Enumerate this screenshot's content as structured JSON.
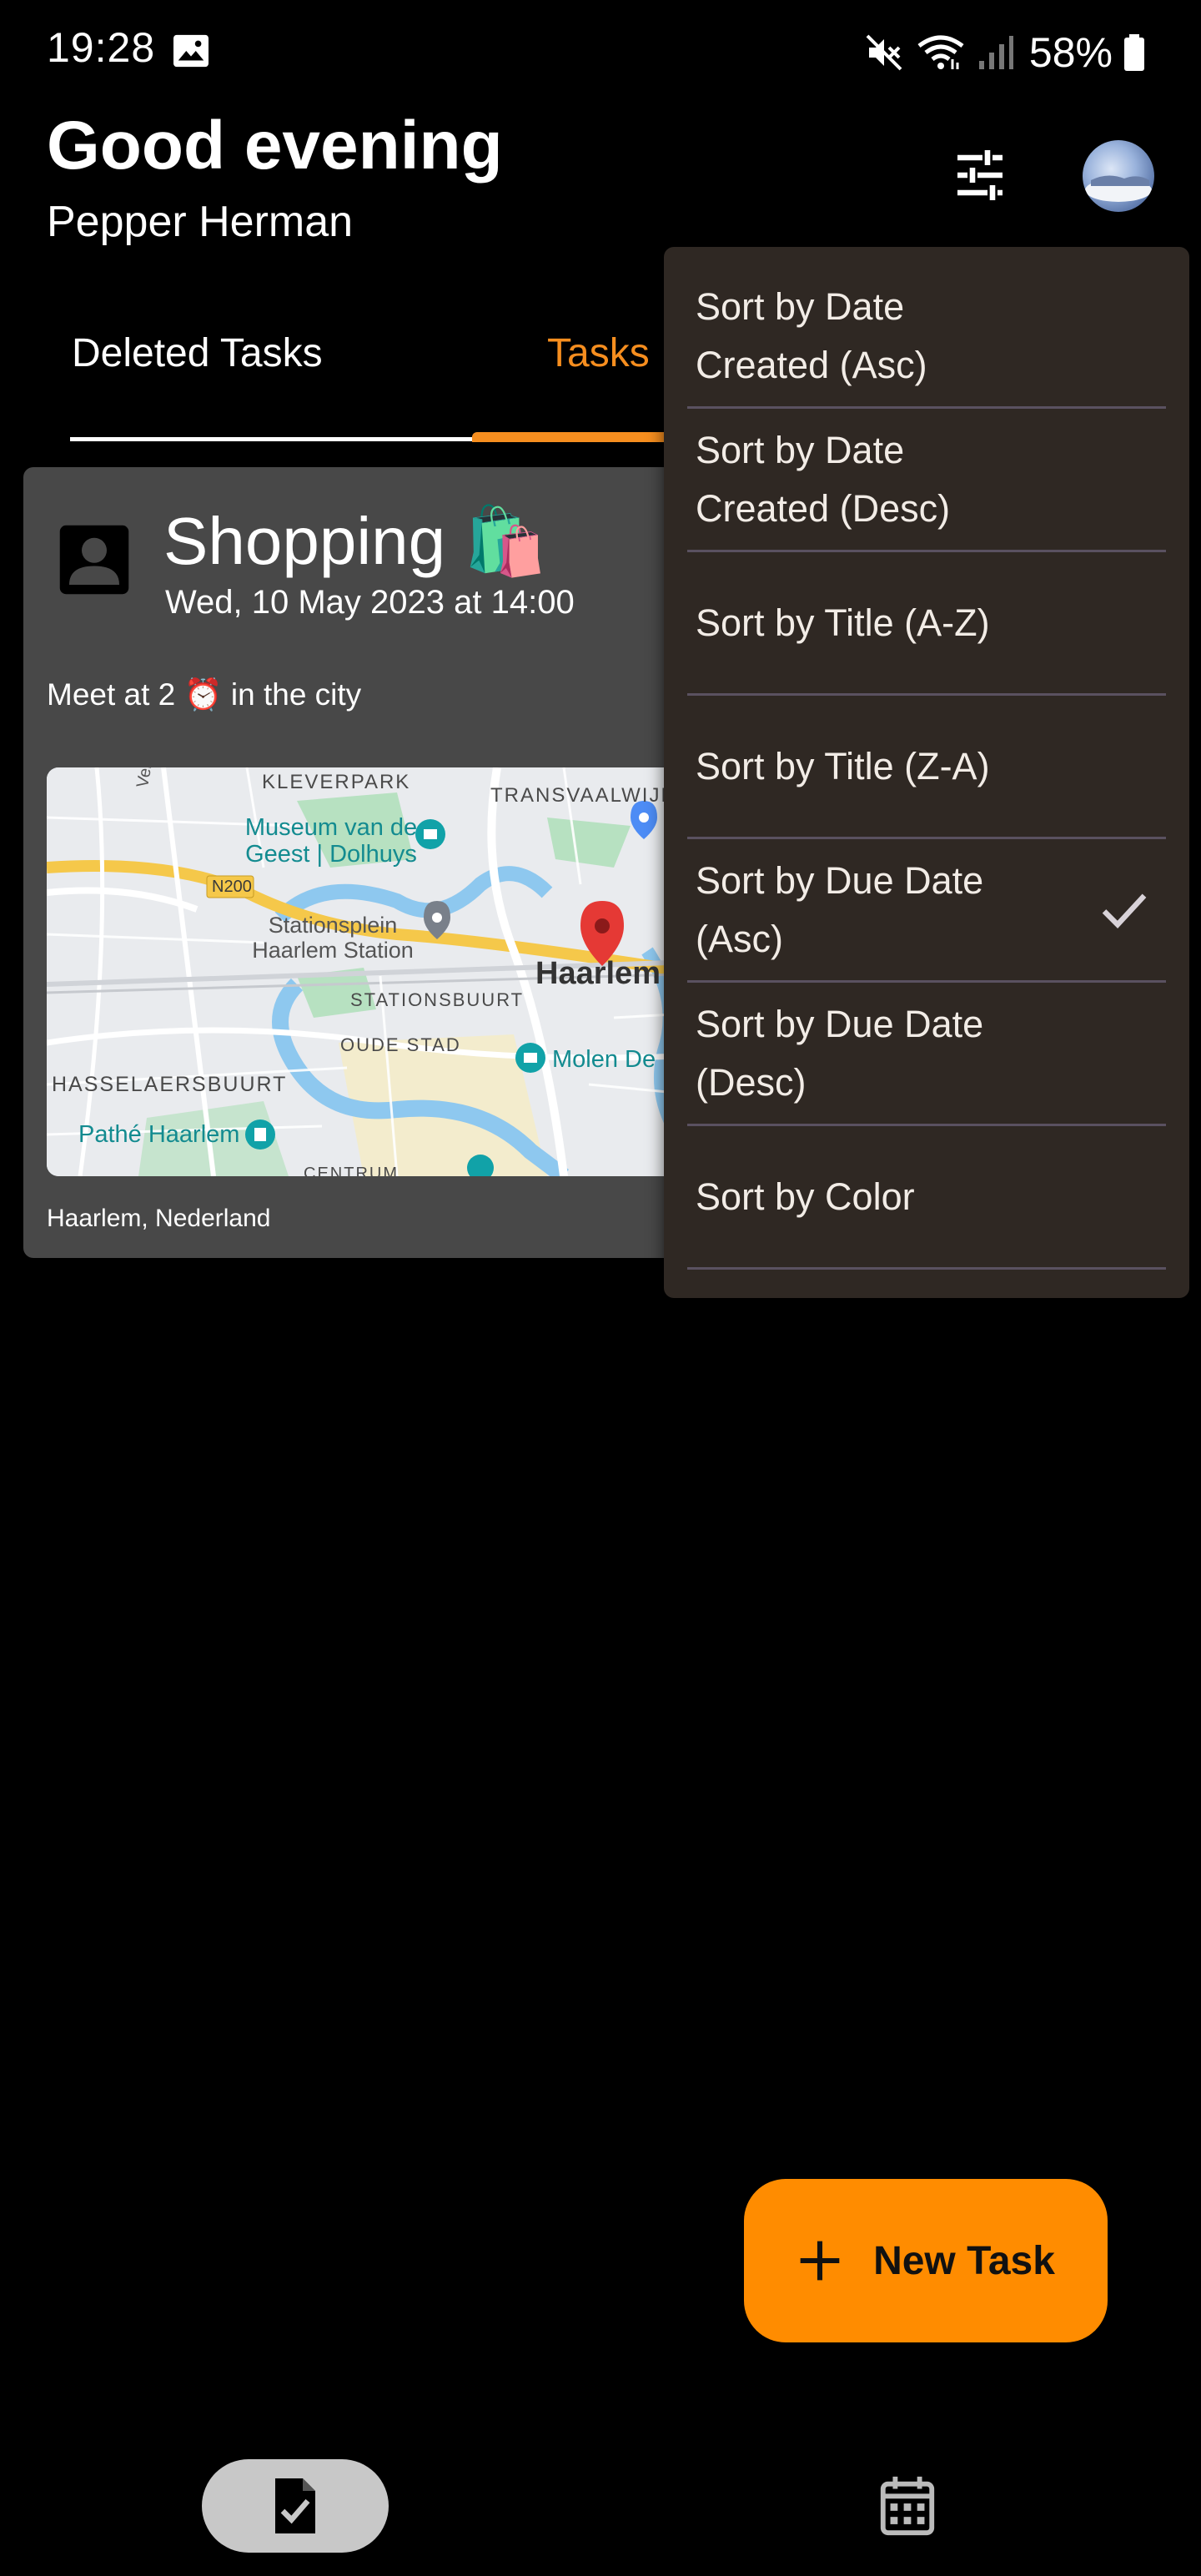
{
  "status_bar": {
    "time": "19:28",
    "battery": "58%",
    "icons": [
      "image-icon",
      "mute-icon",
      "wifi-icon",
      "signal-icon",
      "battery-icon"
    ]
  },
  "header": {
    "greeting": "Good evening",
    "username": "Pepper Herman",
    "filter_icon": "sliders-icon"
  },
  "tabs": [
    {
      "label": "Deleted Tasks",
      "selected": false
    },
    {
      "label": "Tasks",
      "selected": true
    }
  ],
  "task": {
    "title": "Shopping 🛍️",
    "date": "Wed, 10 May 2023 at 14:00",
    "description": "Meet at 2 ⏰ in the city",
    "location": "Haarlem, Nederland",
    "map_labels": {
      "kleverpark": "KLEVERPARK",
      "transvaalwijk": "TRANSVAALWIJK",
      "museum": "Museum van de Geest | Dolhuys",
      "n200": "N200",
      "stationsplein": "Stationsplein Haarlem Station",
      "haarlem": "Haarlem",
      "stationsbuurt": "STATIONSBUURT",
      "oude_stad": "OUDE STAD",
      "molen": "Molen De",
      "hasselaersbuurt": "HASSELAERSBUURT",
      "pathe": "Pathé Haarlem",
      "centrum": "CENTRUM",
      "verspronckweg": "Verspro"
    }
  },
  "sort_menu": {
    "items": [
      {
        "label": "Sort by Date\nCreated (Asc)",
        "checked": false
      },
      {
        "label": "Sort by Date\nCreated (Desc)",
        "checked": false
      },
      {
        "label": "Sort by Title (A-Z)",
        "checked": false
      },
      {
        "label": "Sort by Title (Z-A)",
        "checked": false
      },
      {
        "label": "Sort by Due Date\n(Asc)",
        "checked": true
      },
      {
        "label": "Sort by Due Date\n(Desc)",
        "checked": false
      },
      {
        "label": "Sort by Color",
        "checked": false
      }
    ]
  },
  "fab": {
    "label": "New Task"
  },
  "bottom_nav": {
    "items": [
      {
        "icon": "task-check-icon",
        "selected": true
      },
      {
        "icon": "calendar-icon",
        "selected": false
      }
    ]
  },
  "colors": {
    "accent": "#ff8c00",
    "menu_bg": "#2f2823",
    "card_bg": "#484848"
  }
}
